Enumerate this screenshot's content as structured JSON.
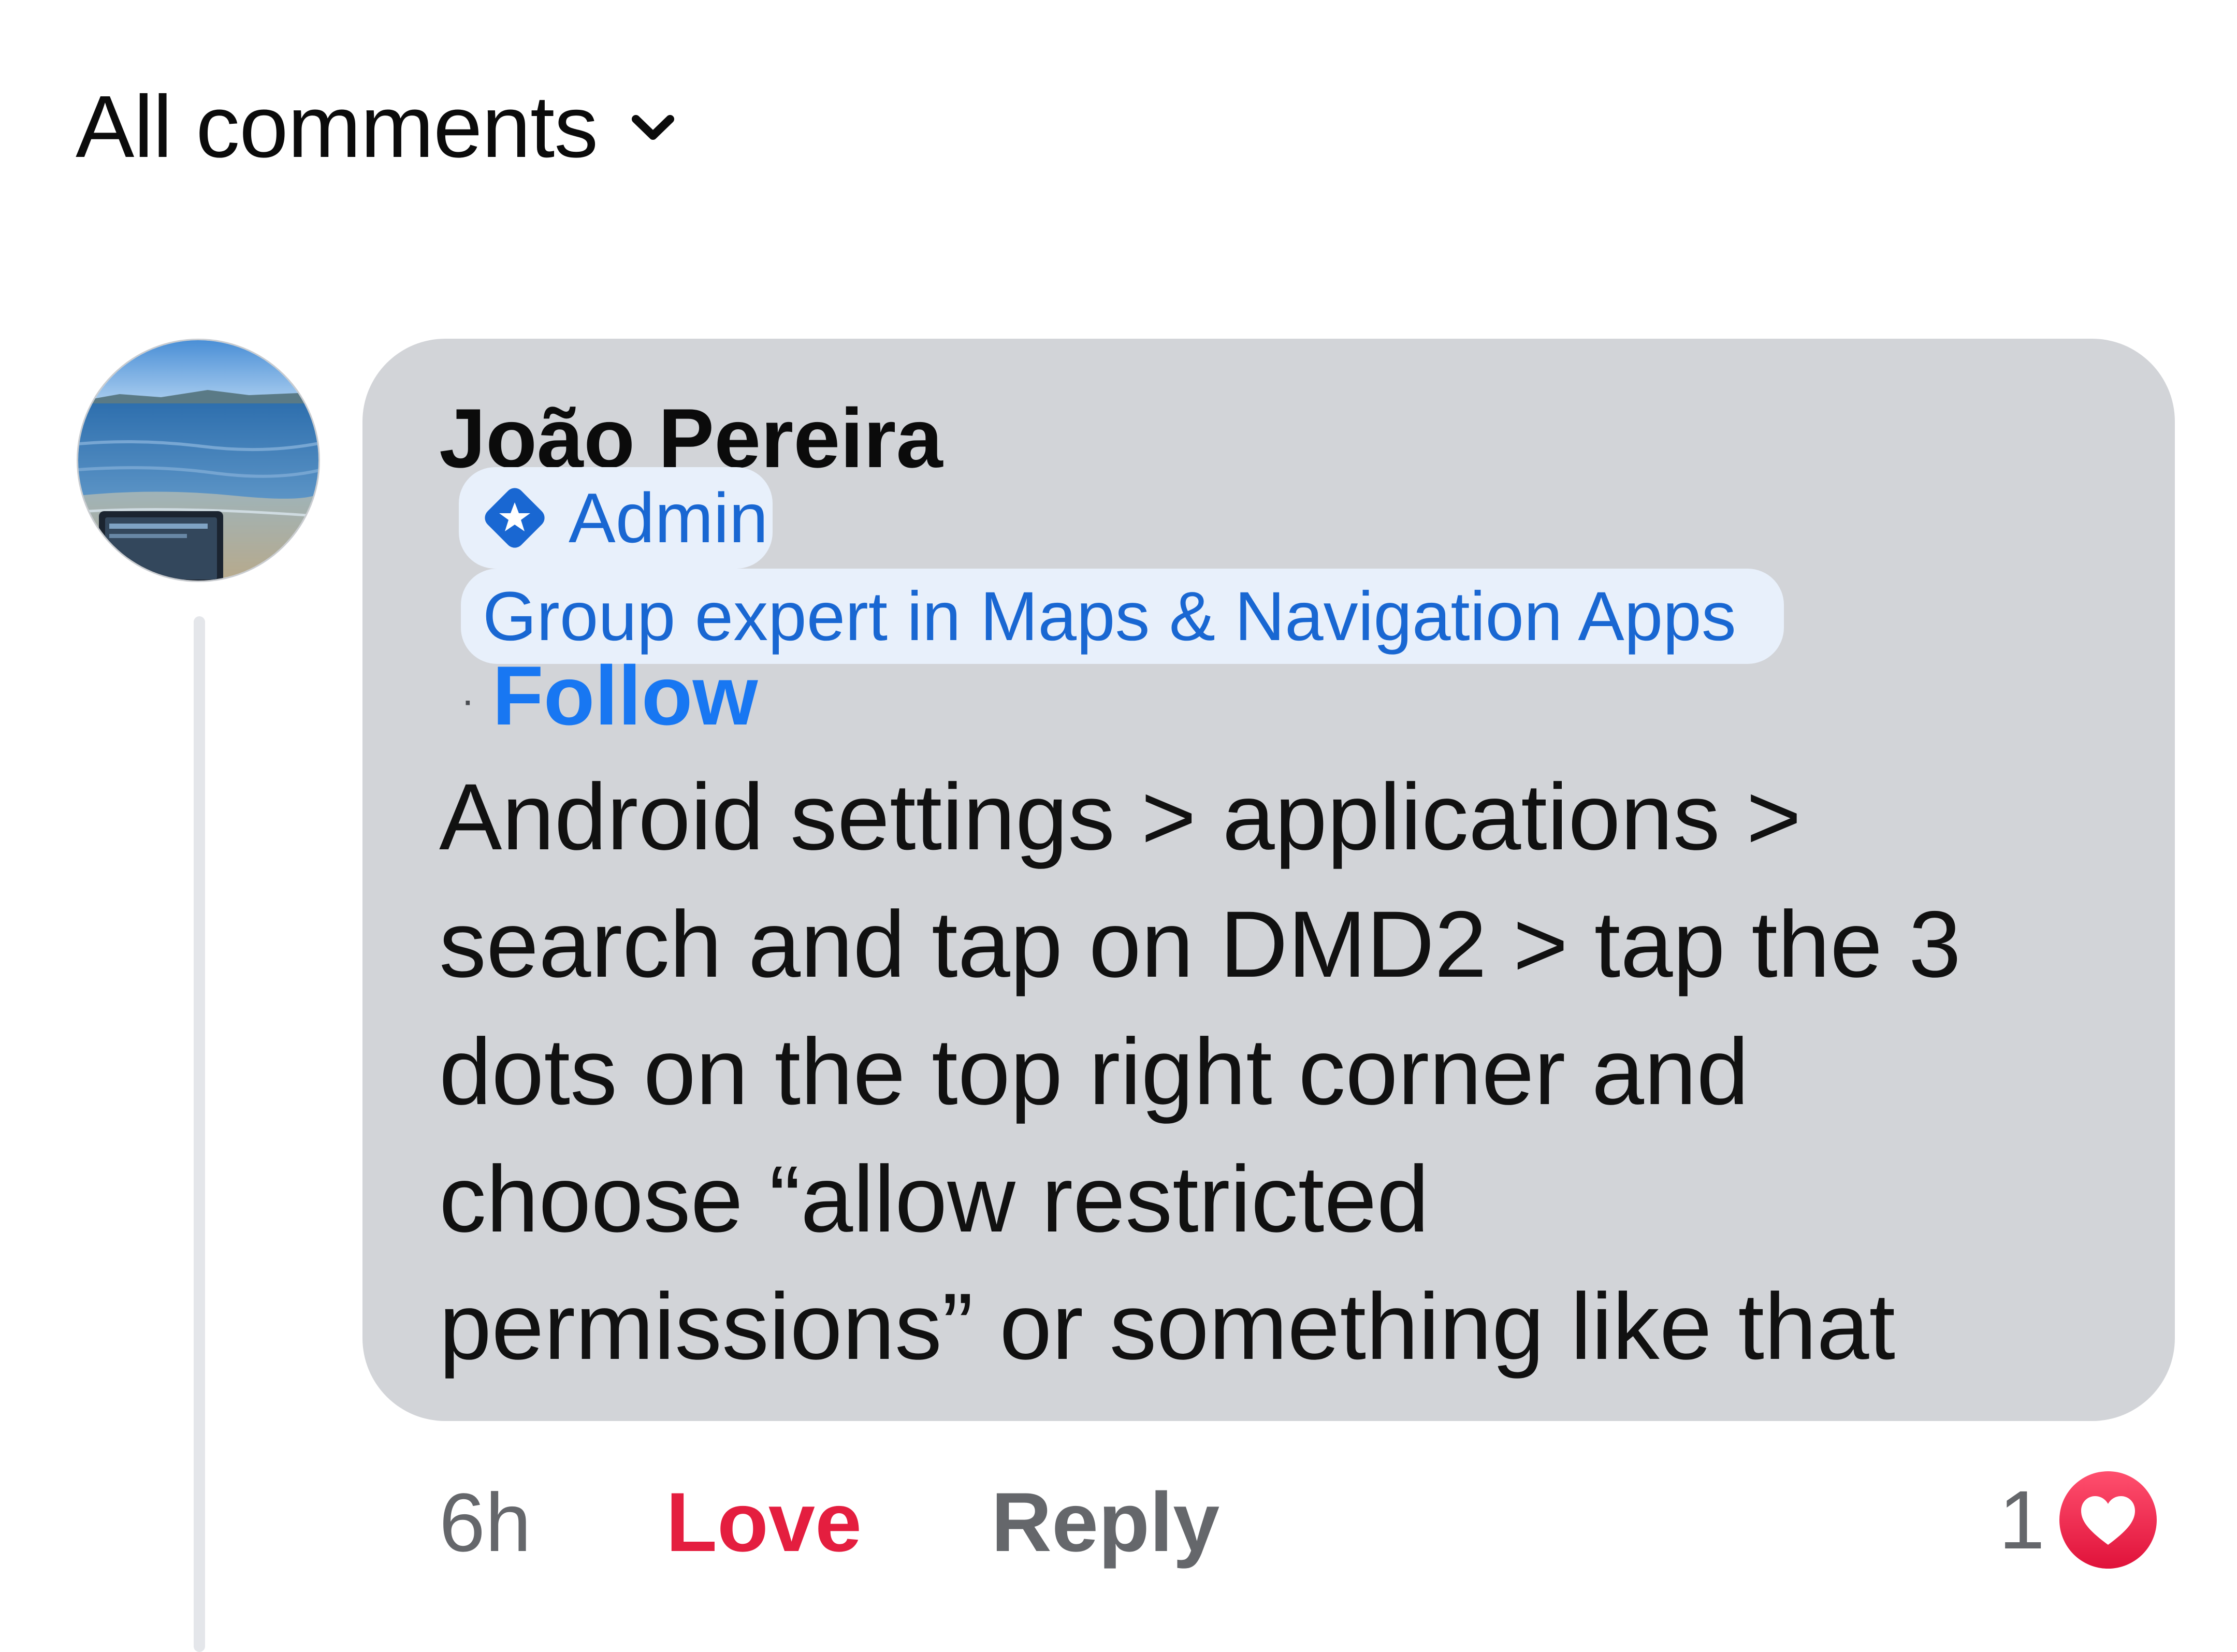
{
  "header": {
    "filter_label": "All comments",
    "chevron_icon": "chevron-down-icon"
  },
  "comment": {
    "avatar_icon": "user-avatar-lake-photo",
    "author": "João Pereira",
    "badges": {
      "admin": "Admin",
      "admin_icon": "admin-shield-star-icon",
      "expert": "Group expert in Maps & Navigation Apps"
    },
    "follow_separator": "·",
    "follow_label": "Follow",
    "text_lines": [
      "Android settings > applications >",
      "search and tap on DMD2 > tap the 3",
      "dots on the top right corner and",
      "choose “allow restricted",
      "permissions” or something like that"
    ],
    "timestamp": "6h",
    "love_label": "Love",
    "reply_label": "Reply",
    "reaction_count": "1",
    "reaction_icon": "love-heart-icon"
  },
  "colors": {
    "bubble": "#d2d4d8",
    "link_blue": "#1877f2",
    "badge_blue": "#1967d2",
    "badge_bg": "#e8f0fb",
    "love_red": "#e41e3f",
    "secondary_text": "#65676b"
  }
}
